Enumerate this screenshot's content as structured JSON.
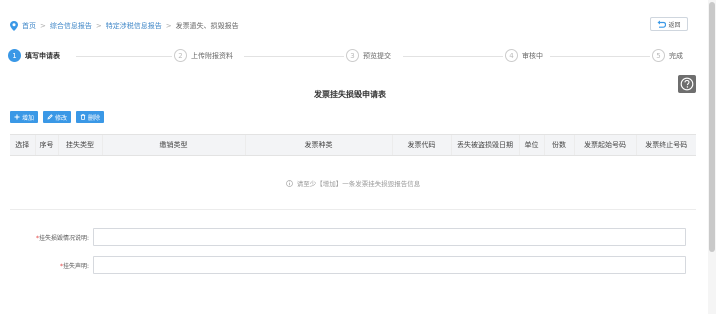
{
  "breadcrumb": {
    "items": [
      "首页",
      "综合信息报告",
      "特定涉税信息报告"
    ],
    "separator": ">",
    "current": "发票遗失、损毁报告"
  },
  "back_button": {
    "label": "返回"
  },
  "steps": [
    {
      "number": "1",
      "label": "填写申请表",
      "active": true
    },
    {
      "number": "2",
      "label": "上传附报资料",
      "active": false
    },
    {
      "number": "3",
      "label": "预览提交",
      "active": false
    },
    {
      "number": "4",
      "label": "审核中",
      "active": false
    },
    {
      "number": "5",
      "label": "完成",
      "active": false
    }
  ],
  "form_title": "发票挂失损毁申请表",
  "toolbar": {
    "add_label": "增加",
    "edit_label": "修改",
    "delete_label": "删除"
  },
  "table": {
    "columns": [
      "选择",
      "序号",
      "挂失类型",
      "缴销类型",
      "发票种类",
      "发票代码",
      "丢失被盗损毁日期",
      "单位",
      "份数",
      "发票起始号码",
      "发票终止号码"
    ],
    "empty_message": "请至少【增加】一条发票挂失损毁报告信息"
  },
  "fields": {
    "situation_label": "挂失损毁情况说明:",
    "situation_value": "",
    "statement_label": "挂失声明:",
    "statement_value": ""
  },
  "colors": {
    "accent": "#3a98e6",
    "link": "#3e86c7",
    "required": "#e34040",
    "header_bg": "#f3f4f6"
  }
}
